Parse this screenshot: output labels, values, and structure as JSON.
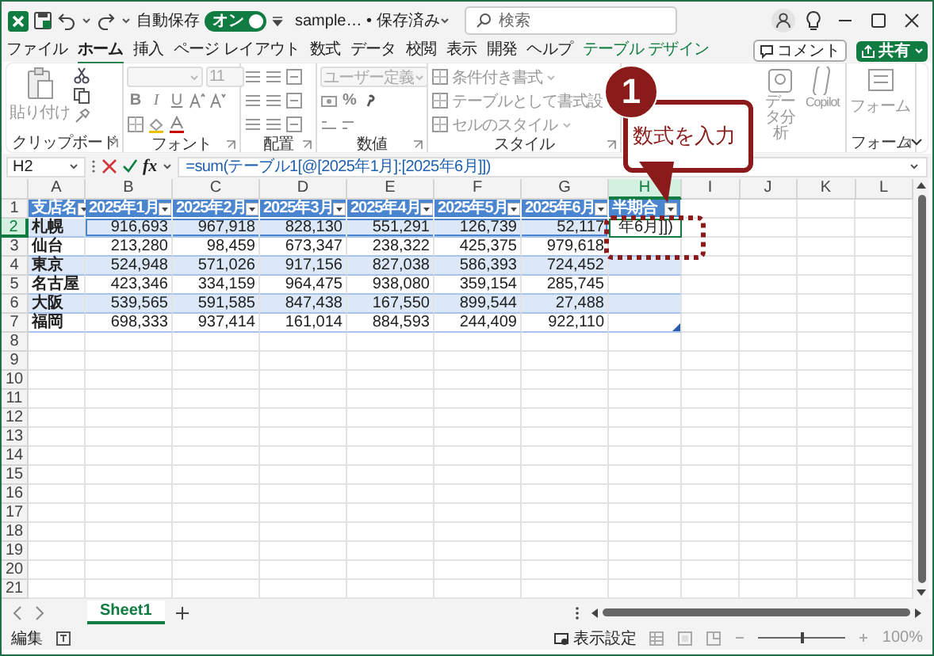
{
  "title_bar": {
    "autosave_label": "自動保存",
    "autosave_on": true,
    "toggle_text": "オン",
    "filename": "sample… • 保存済み",
    "search_placeholder": "検索"
  },
  "menu_tabs": [
    {
      "label": "ファイル",
      "selected": false,
      "kind": "normal"
    },
    {
      "label": "ホーム",
      "selected": true,
      "kind": "normal"
    },
    {
      "label": "挿入",
      "selected": false,
      "kind": "normal"
    },
    {
      "label": "ページ レイアウト",
      "selected": false,
      "kind": "normal"
    },
    {
      "label": "数式",
      "selected": false,
      "kind": "normal"
    },
    {
      "label": "データ",
      "selected": false,
      "kind": "normal"
    },
    {
      "label": "校閲",
      "selected": false,
      "kind": "normal"
    },
    {
      "label": "表示",
      "selected": false,
      "kind": "normal"
    },
    {
      "label": "開発",
      "selected": false,
      "kind": "normal"
    },
    {
      "label": "ヘルプ",
      "selected": false,
      "kind": "normal"
    },
    {
      "label": "テーブル デザイン",
      "selected": false,
      "kind": "contextual"
    }
  ],
  "comment_button": "コメント",
  "share_button": "共有",
  "ribbon": {
    "groups": [
      {
        "kind": "clipboard",
        "label": "クリップボード",
        "paste_label": "貼り付け"
      },
      {
        "kind": "font",
        "label": "フォント",
        "font_size": "11",
        "style_buttons": [
          "B",
          "I",
          "U"
        ]
      },
      {
        "kind": "alignment",
        "label": "配置"
      },
      {
        "kind": "number",
        "label": "数値",
        "format": "ユーザー定義",
        "percent": "%"
      },
      {
        "kind": "styles",
        "label": "スタイル",
        "commands": [
          "条件付き書式",
          "テーブルとして書式設",
          "セルのスタイル"
        ]
      },
      {
        "kind": "analysis",
        "commands": [
          "データ分析",
          "Copilot"
        ]
      },
      {
        "kind": "form",
        "label": "フォーム",
        "commands": [
          "フォーム"
        ]
      }
    ]
  },
  "formula_bar": {
    "name_box": "H2",
    "function_label": "fx",
    "formula": "=sum(テーブル1[@[2025年1月]:[2025年6月]])"
  },
  "grid": {
    "columns": [
      "A",
      "B",
      "C",
      "D",
      "E",
      "F",
      "G",
      "H",
      "I",
      "J",
      "K",
      "L"
    ],
    "row_numbers": [
      "1",
      "2",
      "3",
      "4",
      "5",
      "6",
      "7",
      "8",
      "9",
      "10",
      "11",
      "12",
      "13",
      "14",
      "15",
      "16",
      "17",
      "18",
      "19",
      "20",
      "21"
    ]
  },
  "table": {
    "headers": [
      "支店名",
      "2025年1月",
      "2025年2月",
      "2025年3月",
      "2025年4月",
      "2025年5月",
      "2025年6月",
      "半期合"
    ],
    "rows": [
      {
        "branch": "札幌",
        "values": [
          "916,693",
          "967,918",
          "828,130",
          "551,291",
          "126,739",
          "52,117"
        ],
        "total": "年6月]])",
        "active": true,
        "referenced": true
      },
      {
        "branch": "仙台",
        "values": [
          "213,280",
          "98,459",
          "673,347",
          "238,322",
          "425,375",
          "979,618"
        ],
        "active": false,
        "referenced": false
      },
      {
        "branch": "東京",
        "values": [
          "524,948",
          "571,026",
          "917,156",
          "827,038",
          "586,393",
          "724,452"
        ],
        "active": false,
        "referenced": false
      },
      {
        "branch": "名古屋",
        "values": [
          "423,346",
          "334,159",
          "964,475",
          "938,080",
          "359,154",
          "285,745"
        ],
        "active": false,
        "referenced": false
      },
      {
        "branch": "大阪",
        "values": [
          "539,565",
          "591,585",
          "847,438",
          "167,550",
          "899,544",
          "27,488"
        ],
        "active": false,
        "referenced": false
      },
      {
        "branch": "福岡",
        "values": [
          "698,333",
          "937,414",
          "161,014",
          "884,593",
          "244,409",
          "922,110"
        ],
        "active": false,
        "referenced": false
      }
    ]
  },
  "sheet_tabs": [
    {
      "label": "Sheet1",
      "selected": true
    }
  ],
  "status_bar": {
    "mode": "編集",
    "display_settings": "表示設定",
    "zoom": "100%",
    "zoom_level": {
      "level": 0.5
    }
  },
  "callout": {
    "number": "1",
    "text": "数式を入力"
  }
}
